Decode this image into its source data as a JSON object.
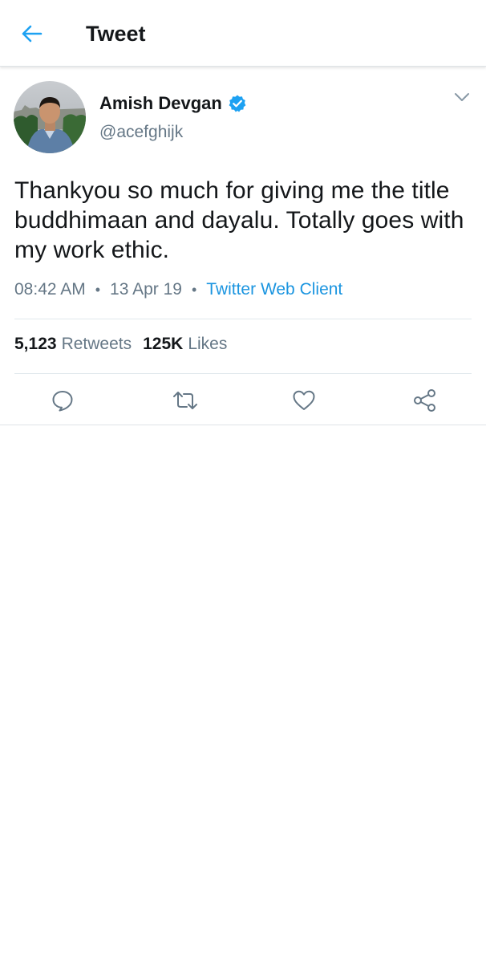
{
  "header": {
    "title": "Tweet",
    "back_icon": "arrow-left-icon",
    "accent_color": "#1da1f2"
  },
  "tweet": {
    "author": {
      "name": "Amish Devgan",
      "handle": "@acefghijk",
      "verified": true,
      "verified_color": "#1da1f2"
    },
    "text": "Thankyou so much for giving me the title buddhimaan and dayalu. Totally goes with my work ethic.",
    "time": "08:42 AM",
    "date": "13 Apr 19",
    "client": "Twitter Web Client",
    "separator": "•",
    "stats": {
      "retweets_count": "5,123",
      "retweets_label": "Retweets",
      "likes_count": "125K",
      "likes_label": "Likes"
    },
    "actions": [
      "reply-icon",
      "retweet-icon",
      "like-icon",
      "share-icon"
    ],
    "link_color": "#1b95e0",
    "muted_color": "#657786"
  }
}
